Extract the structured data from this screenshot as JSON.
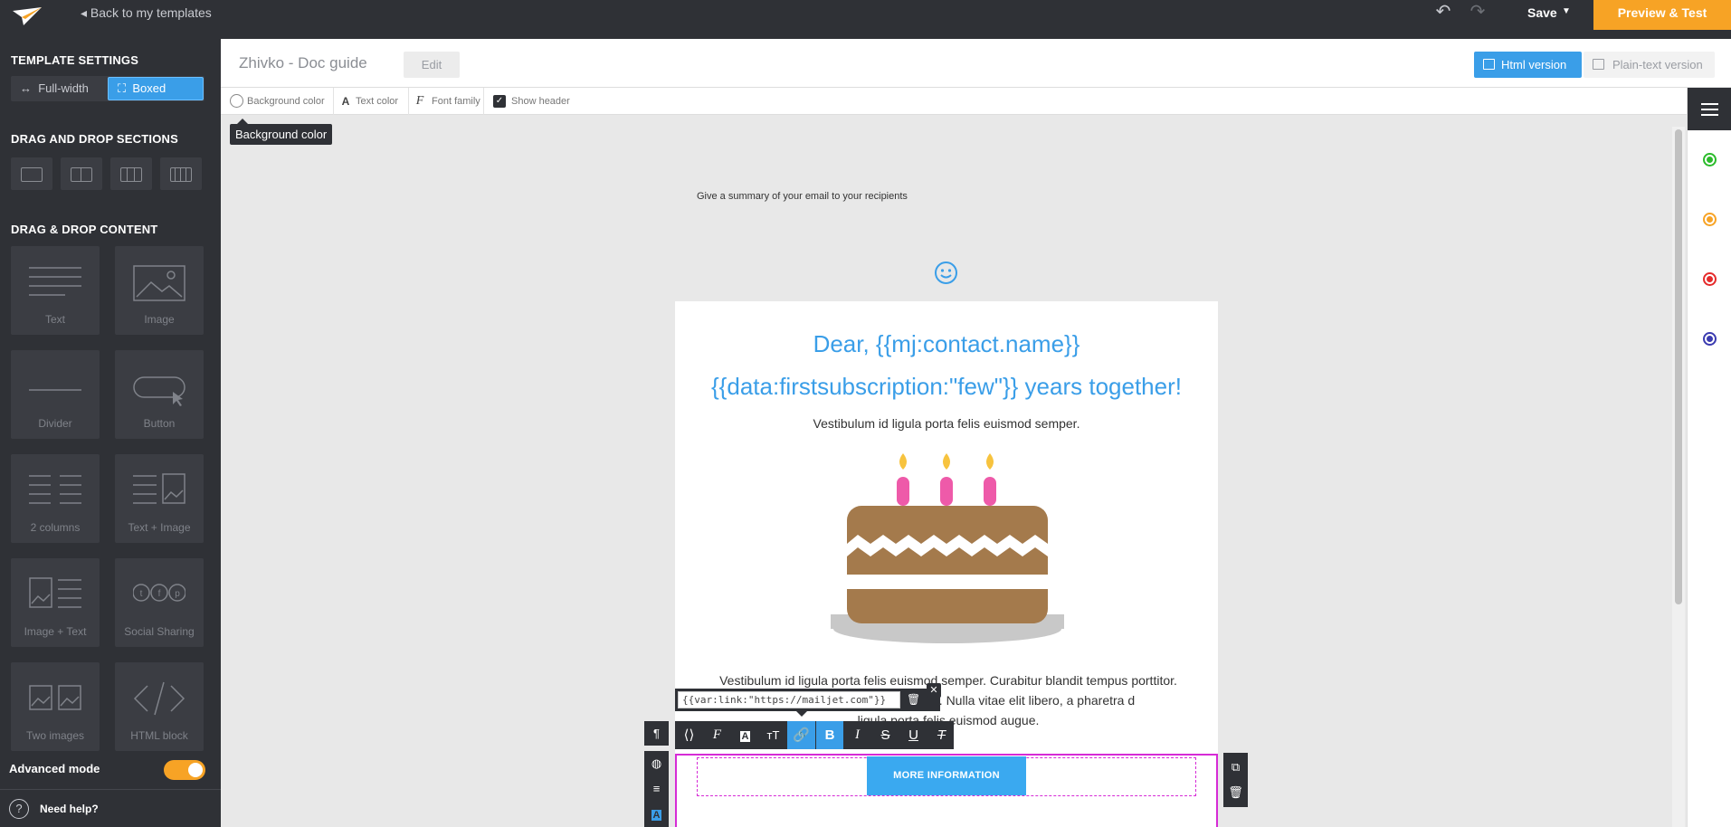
{
  "topbar": {
    "back_label": "◂ Back to my templates",
    "save_label": "Save",
    "save_caret": "▼",
    "preview_label": "Preview & Test"
  },
  "sidebar": {
    "template_settings_title": "TEMPLATE SETTINGS",
    "full_width_label": "Full-width",
    "boxed_label": "Boxed",
    "sections_title": "DRAG AND DROP SECTIONS",
    "content_title": "DRAG & DROP CONTENT",
    "tiles": [
      "Text",
      "Image",
      "Divider",
      "Button",
      "2 columns",
      "Text + Image",
      "Image + Text",
      "Social Sharing",
      "Two images",
      "HTML block"
    ],
    "advanced_mode_label": "Advanced mode",
    "advanced_mode_on": true,
    "help_label": "Need help?"
  },
  "header": {
    "template_name": "Zhivko  -  Doc guide",
    "edit_label": "Edit",
    "html_version_label": "Html version",
    "plain_version_label": "Plain-text version"
  },
  "styles_bar": {
    "background_color_label": "Background color",
    "text_color_label": "Text color",
    "font_family_label": "Font family",
    "show_header_label": "Show header",
    "show_header_checked": true
  },
  "tooltip": "Background color",
  "email": {
    "summary": "Give a summary of your email to your recipients",
    "headline_1": "Dear,  {{mj:contact.name}}",
    "headline_2": "{{data:firstsubscription:\"few\"}}  years together!",
    "intro": "Vestibulum id ligula porta felis euismod semper.",
    "paragraph_line_1": "Vestibulum id ligula porta felis euismod semper. Curabitur blandit tempus porttitor.",
    "paragraph_line_2": "semper. Nulla vitae elit libero, a pharetra d",
    "paragraph_line_3": "ligula porta felis euismod augue.",
    "button_label": "MORE INFORMATION"
  },
  "link_editor": {
    "value": "{{var:link:\"https://mailjet.com\"}}"
  },
  "colors": {
    "dark": "#2f3136",
    "accent_blue": "#3a9ee8",
    "accent_orange": "#f7a325",
    "selection_magenta": "#d62bd6",
    "rail_green": "#2bbb2b",
    "rail_orange": "#f7a325",
    "rail_red": "#e52b2b",
    "rail_indigo": "#3b3bb0"
  }
}
